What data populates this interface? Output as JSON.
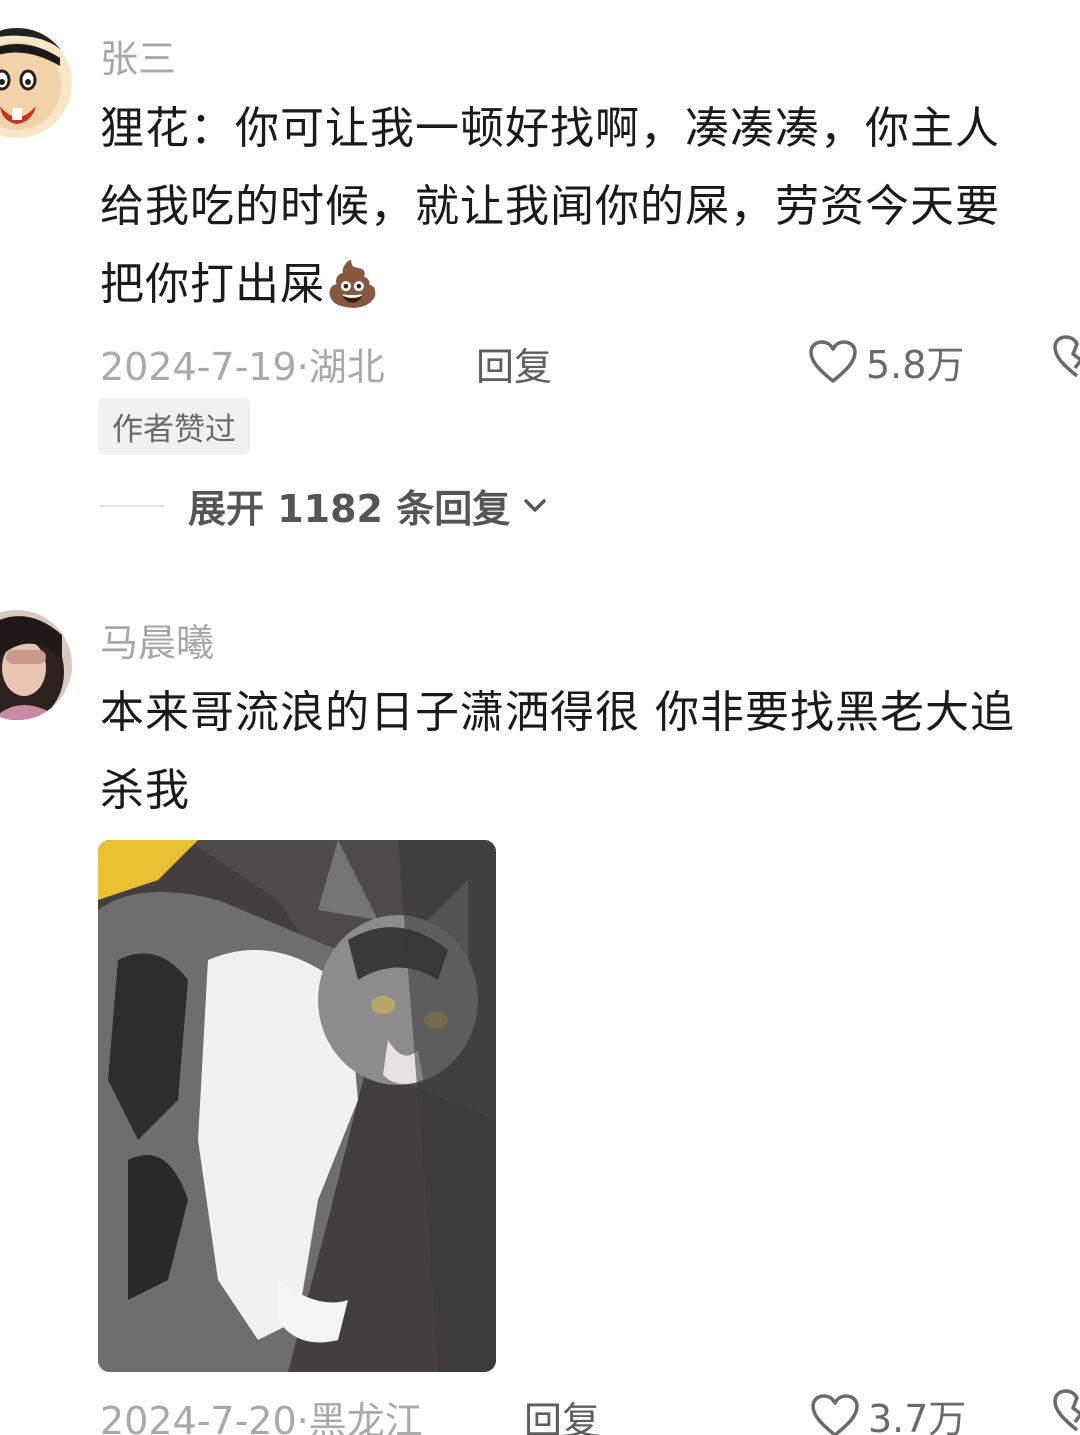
{
  "comments": [
    {
      "username": "张三",
      "text_lines": [
        "狸花：你可让我一顿好找啊，凑凑凑，你主人",
        "给我吃的时候，就让我闻你的屎，劳资今天要",
        "把你打出屎"
      ],
      "emoji": "💩",
      "date": "2024-7-19",
      "location": "湖北",
      "reply_label": "回复",
      "likes": "5.8万",
      "badge": "作者赞过",
      "expand_label": "展开 1182 条回复"
    },
    {
      "username": "马晨曦",
      "text_lines": [
        "本来哥流浪的日子潇洒得很 你非要找黑老大追",
        "杀我"
      ],
      "date": "2024-7-20",
      "location": "黑龙江",
      "reply_label": "回复",
      "likes": "3.7万"
    }
  ],
  "icons": {
    "like": "heart-outline-icon",
    "dislike": "broken-heart-icon",
    "expand": "chevron-down-icon"
  },
  "colors": {
    "text": "#1a1a1a",
    "meta": "#a9a9ad",
    "username": "#a7a7ab"
  }
}
